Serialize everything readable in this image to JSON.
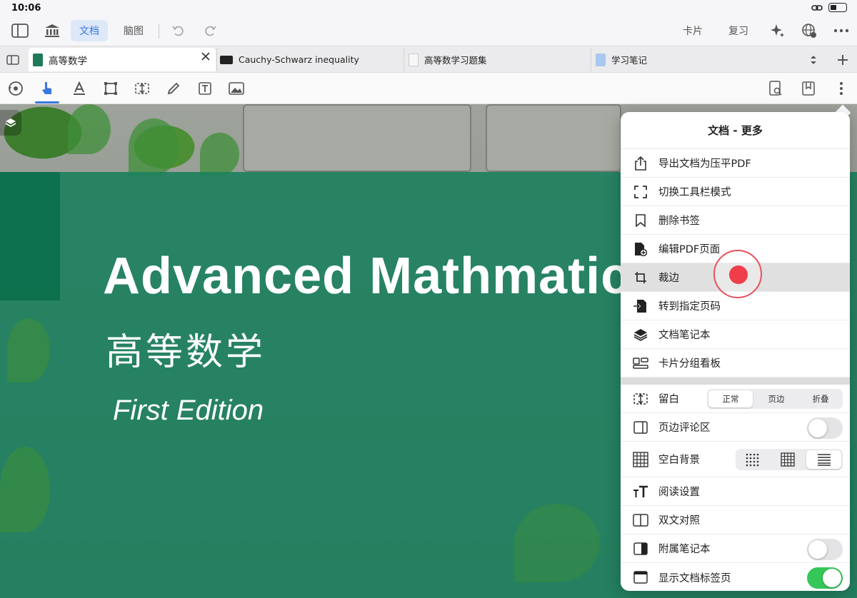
{
  "status": {
    "time": "10:06"
  },
  "topbar": {
    "seg_doc": "文档",
    "seg_mind": "脑图",
    "card": "卡片",
    "review": "复习"
  },
  "tabs": [
    {
      "label": "高等数学",
      "color": "#1f7a57"
    },
    {
      "label": "Cauchy-Schwarz inequality",
      "color": "#222"
    },
    {
      "label": "高等数学习题集",
      "color": "#f4f4f4"
    },
    {
      "label": "学习笔记",
      "color": "#a9c8ef"
    }
  ],
  "document": {
    "title_en": "Advanced Mathmatics",
    "title_cn": "高等数学",
    "edition": "First Edition"
  },
  "popover": {
    "title": "文档 - 更多",
    "actions": [
      {
        "label": "导出文档为压平PDF",
        "icon": "share-icon"
      },
      {
        "label": "切换工具栏模式",
        "icon": "expand-icon"
      },
      {
        "label": "删除书签",
        "icon": "bookmark-icon"
      },
      {
        "label": "编辑PDF页面",
        "icon": "edit-page-icon"
      },
      {
        "label": "裁边",
        "icon": "crop-icon"
      },
      {
        "label": "转到指定页码",
        "icon": "goto-page-icon"
      },
      {
        "label": "文档笔记本",
        "icon": "layers-icon"
      },
      {
        "label": "卡片分组看板",
        "icon": "board-icon"
      }
    ],
    "margin": {
      "label": "留白",
      "options": [
        "正常",
        "页边",
        "折叠"
      ],
      "selected": "正常"
    },
    "margin_comments": {
      "label": "页边评论区",
      "on": false
    },
    "blank_bg": {
      "label": "空白背景",
      "selected_index": 2
    },
    "reading": {
      "label": "阅读设置"
    },
    "bilingual": {
      "label": "双文对照"
    },
    "attached_notebook": {
      "label": "附属笔记本",
      "on": false
    },
    "show_tabs": {
      "label": "显示文档标签页",
      "on": true
    }
  }
}
